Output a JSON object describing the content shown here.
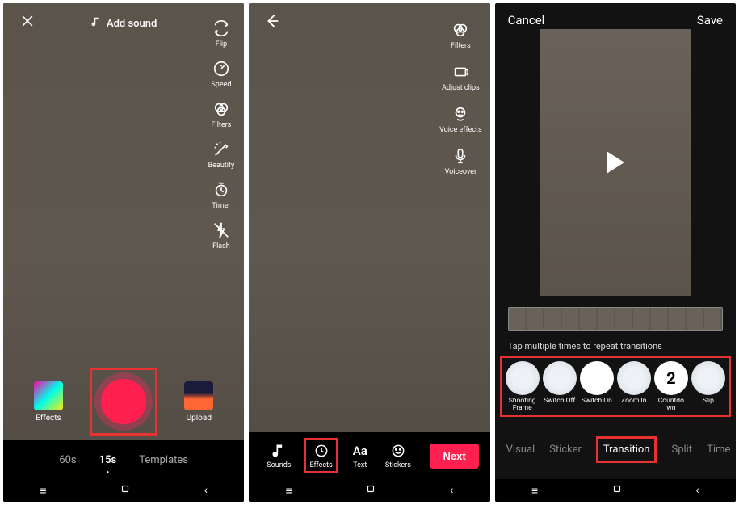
{
  "screen1": {
    "add_sound_label": "Add sound",
    "side_tools": [
      {
        "label": "Flip",
        "icon": "flip"
      },
      {
        "label": "Speed",
        "icon": "speed"
      },
      {
        "label": "Filters",
        "icon": "filters"
      },
      {
        "label": "Beautify",
        "icon": "beautify"
      },
      {
        "label": "Timer",
        "icon": "timer"
      },
      {
        "label": "Flash",
        "icon": "flash"
      }
    ],
    "effects_label": "Effects",
    "upload_label": "Upload",
    "durations": [
      {
        "label": "60s",
        "active": false
      },
      {
        "label": "15s",
        "active": true
      },
      {
        "label": "Templates",
        "active": false
      }
    ]
  },
  "screen2": {
    "side_tools": [
      {
        "label": "Filters",
        "icon": "filters"
      },
      {
        "label": "Adjust clips",
        "icon": "adjust"
      },
      {
        "label": "Voice effects",
        "icon": "voice"
      },
      {
        "label": "Voiceover",
        "icon": "mic"
      }
    ],
    "bottom_tools": [
      {
        "label": "Sounds",
        "icon": "music"
      },
      {
        "label": "Effects",
        "icon": "effects",
        "highlight": true
      },
      {
        "label": "Text",
        "icon": "text"
      },
      {
        "label": "Stickers",
        "icon": "stickers"
      }
    ],
    "next_label": "Next"
  },
  "screen3": {
    "cancel_label": "Cancel",
    "save_label": "Save",
    "hint": "Tap multiple times to repeat transitions",
    "transitions": [
      {
        "label": "Shooting Frame",
        "thumb": "scene"
      },
      {
        "label": "Switch Off",
        "thumb": "scene"
      },
      {
        "label": "Switch On",
        "thumb": "plain"
      },
      {
        "label": "Zoom In",
        "thumb": "scene"
      },
      {
        "label": "Countdo wn",
        "thumb": "number",
        "value": "2"
      },
      {
        "label": "Slip",
        "thumb": "scene"
      }
    ],
    "categories": [
      {
        "label": "Visual",
        "active": false
      },
      {
        "label": "Sticker",
        "active": false
      },
      {
        "label": "Transition",
        "active": true
      },
      {
        "label": "Split",
        "active": false
      },
      {
        "label": "Time",
        "active": false
      }
    ]
  }
}
